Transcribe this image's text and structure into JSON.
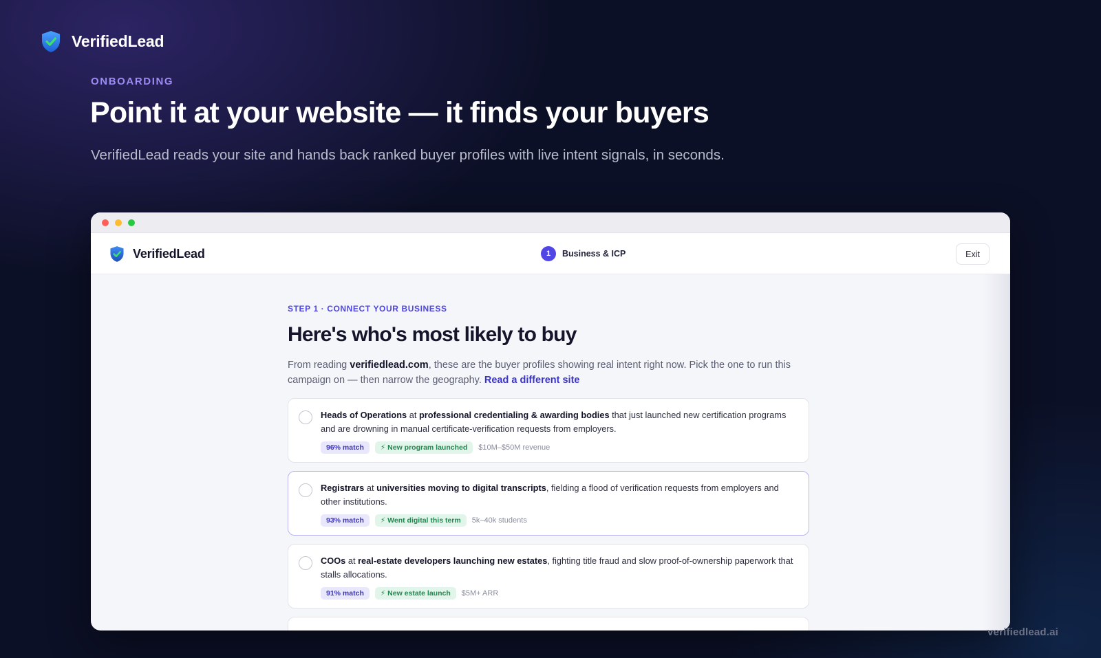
{
  "hero": {
    "brand_name": "VerifiedLead",
    "eyebrow": "ONBOARDING",
    "headline": "Point it at your website — it finds your buyers",
    "subhead": "VerifiedLead reads your site and hands back ranked buyer profiles with live intent signals, in seconds."
  },
  "window": {
    "app_bar": {
      "brand_name": "VerifiedLead",
      "step_number": "1",
      "step_label": "Business & ICP",
      "exit_label": "Exit"
    },
    "step": {
      "eyebrow": "STEP 1 · CONNECT YOUR BUSINESS",
      "title": "Here's who's most likely to buy",
      "desc_prefix": "From reading ",
      "desc_domain": "verifiedlead.com",
      "desc_suffix": ", these are the buyer profiles showing real intent right now. Pick the one to run this campaign on — then narrow the geography. ",
      "desc_link": "Read a different site"
    },
    "profiles": [
      {
        "role": "Heads of Operations",
        "at": " at ",
        "segment": "professional credentialing & awarding bodies",
        "rest": " that just launched new certification programs and are drowning in manual certificate-verification requests from employers.",
        "match": "96% match",
        "signal": "⚡ New program launched",
        "meta": "$10M–$50M revenue",
        "selected": false
      },
      {
        "role": "Registrars",
        "at": " at ",
        "segment": "universities moving to digital transcripts",
        "rest": ", fielding a flood of verification requests from employers and other institutions.",
        "match": "93% match",
        "signal": "⚡ Went digital this term",
        "meta": "5k–40k students",
        "selected": true
      },
      {
        "role": "COOs",
        "at": " at ",
        "segment": "real-estate developers launching new estates",
        "rest": ", fighting title fraud and slow proof-of-ownership paperwork that stalls allocations.",
        "match": "91% match",
        "signal": "⚡ New estate launch",
        "meta": "$5M+ ARR",
        "selected": false
      }
    ]
  },
  "footer": {
    "watermark": "verifiedlead.ai"
  },
  "colors": {
    "accent": "#4f46e5",
    "background": "#0c1026",
    "eyebrow": "#9b8cf5",
    "signal": "#1c8a4e"
  }
}
